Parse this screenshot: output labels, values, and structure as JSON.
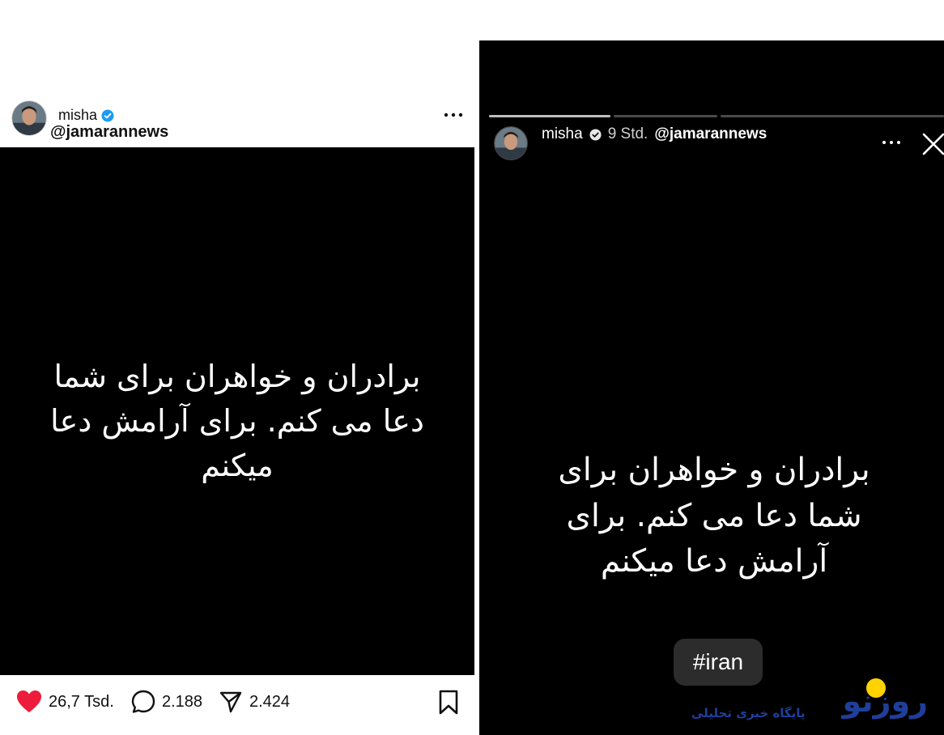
{
  "post": {
    "username": "misha",
    "mention": "@jamarannews",
    "image_text": "برادران و خواهران برای شما دعا می کنم. برای آرامش دعا میکنم",
    "likes": "26,7 Tsd.",
    "comments": "2.188",
    "shares": "2.424"
  },
  "story": {
    "username": "misha",
    "time": "9 Std.",
    "mention": "@jamarannews",
    "image_text": "برادران و خواهران برای شما دعا می کنم. برای آرامش دعا میکنم",
    "hashtag": "#iran",
    "progress_segments": [
      1.0,
      0.0,
      0.0
    ]
  },
  "watermark": {
    "logo_text": "روزنو",
    "tagline": "پایگاه خبری تحلیلی"
  },
  "colors": {
    "verified": "#1d9bf0",
    "like_heart": "#ed1c3a",
    "logo_blue": "#1f3f9a",
    "logo_yellow": "#ffd200"
  },
  "icons": [
    "verified-badge-icon",
    "more-options-icon",
    "heart-icon",
    "comment-icon",
    "share-icon",
    "bookmark-icon",
    "close-icon"
  ]
}
